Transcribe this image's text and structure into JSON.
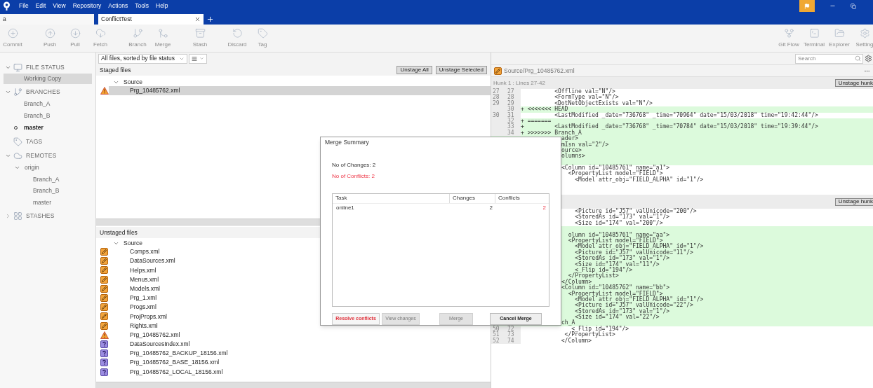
{
  "menu": [
    "File",
    "Edit",
    "View",
    "Repository",
    "Actions",
    "Tools",
    "Help"
  ],
  "tabs": [
    {
      "label": "a",
      "selected": false
    },
    {
      "label": "ConflictTest",
      "selected": true
    }
  ],
  "toolbar": {
    "left": [
      [
        {
          "label": "Commit",
          "kind": "commit"
        }
      ],
      [
        {
          "label": "Push",
          "kind": "push"
        },
        {
          "label": "Pull",
          "kind": "pull"
        },
        {
          "label": "Fetch",
          "kind": "fetch"
        }
      ],
      [
        {
          "label": "Branch",
          "kind": "branch"
        },
        {
          "label": "Merge",
          "kind": "merge"
        }
      ],
      [
        {
          "label": "Stash",
          "kind": "stash"
        }
      ],
      [
        {
          "label": "Discard",
          "kind": "discard"
        },
        {
          "label": "Tag",
          "kind": "tag"
        }
      ]
    ],
    "right": [
      {
        "label": "Git Flow",
        "kind": "gitflow"
      },
      {
        "label": "Terminal",
        "kind": "terminal"
      },
      {
        "label": "Explorer",
        "kind": "explorer"
      },
      {
        "label": "Setting",
        "kind": "settings"
      }
    ]
  },
  "sidebar": [
    {
      "label": "FILE STATUS",
      "kind": "status",
      "expanded": true,
      "children": [
        {
          "label": "Working Copy",
          "selected": true
        }
      ]
    },
    {
      "label": "BRANCHES",
      "kind": "branches",
      "expanded": true,
      "children": [
        {
          "label": "Branch_A",
          "current": false
        },
        {
          "label": "Branch_B",
          "current": false
        },
        {
          "label": "master",
          "current": true
        }
      ]
    },
    {
      "label": "TAGS",
      "kind": "tags"
    },
    {
      "label": "REMOTES",
      "kind": "remotes",
      "expanded": true,
      "children": [
        {
          "label": "origin",
          "expanded": true,
          "children": [
            {
              "label": "Branch_A"
            },
            {
              "label": "Branch_B"
            },
            {
              "label": "master"
            }
          ]
        }
      ]
    },
    {
      "label": "STASHES",
      "kind": "stashes",
      "expanded": false
    }
  ],
  "file_filter": "All files, sorted by file status",
  "search": {
    "placeholder": "Search"
  },
  "staged": {
    "title": "Staged files",
    "buttons": [
      "Unstage All",
      "Unstage Selected"
    ],
    "folder": {
      "label": "Source",
      "expanded": true
    },
    "files": [
      {
        "name": "Prg_10485762.xml",
        "kind": "conflict",
        "selected": true
      }
    ]
  },
  "unstaged": {
    "title": "Unstaged files",
    "folder": {
      "label": "Source",
      "expanded": true
    },
    "files": [
      {
        "name": "Comps.xml",
        "kind": "modified",
        "selected": false
      },
      {
        "name": "DataSources.xml",
        "kind": "modified",
        "selected": false
      },
      {
        "name": "Helps.xml",
        "kind": "modified",
        "selected": false
      },
      {
        "name": "Menus.xml",
        "kind": "modified",
        "selected": false
      },
      {
        "name": "Models.xml",
        "kind": "modified",
        "selected": false
      },
      {
        "name": "Prg_1.xml",
        "kind": "modified",
        "selected": false
      },
      {
        "name": "Progs.xml",
        "kind": "modified",
        "selected": false
      },
      {
        "name": "ProjProps.xml",
        "kind": "modified",
        "selected": false
      },
      {
        "name": "Rights.xml",
        "kind": "modified",
        "selected": false
      },
      {
        "name": "Prg_10485762.xml",
        "kind": "conflict",
        "selected": false
      },
      {
        "name": "DataSourcesIndex.xml",
        "kind": "untracked",
        "selected": false
      },
      {
        "name": "Prg_10485762_BACKUP_18156.xml",
        "kind": "untracked",
        "selected": false
      },
      {
        "name": "Prg_10485762_BASE_18156.xml",
        "kind": "untracked",
        "selected": false
      },
      {
        "name": "Prg_10485762_LOCAL_18156.xml",
        "kind": "untracked",
        "selected": false
      }
    ]
  },
  "diff": {
    "path": "Source/Prg_10485762.xml",
    "hunks": [
      {
        "header": "Hunk 1 : Lines 27-42",
        "button": "Unstage hunk",
        "lines": [
          {
            "old": "27",
            "new": "27",
            "kind": "context",
            "text": "          <Offline val=\"N\"/>"
          },
          {
            "old": "28",
            "new": "28",
            "kind": "context",
            "text": "          <FormType val=\"N\"/>"
          },
          {
            "old": "29",
            "new": "29",
            "kind": "context",
            "text": "          <DotNetObjectExists val=\"N\"/>"
          },
          {
            "new": "30",
            "kind": "added",
            "text": "+ <<<<<<< HEAD"
          },
          {
            "old": "30",
            "new": "31",
            "kind": "context",
            "text": "          <LastModified _date=\"736768\" _time=\"70964\" date=\"15/03/2018\" time=\"19:42:44\"/>"
          },
          {
            "new": "32",
            "kind": "added",
            "text": "+ ======="
          },
          {
            "new": "33",
            "kind": "added",
            "text": "+         <LastModified _date=\"736768\" _time=\"70784\" date=\"15/03/2018\" time=\"19:39:44\"/>"
          },
          {
            "new": "34",
            "kind": "added",
            "text": "+ >>>>>>> Branch_A"
          },
          {
            "kind": "added",
            "covered": true,
            "text": "ader>"
          },
          {
            "kind": "added",
            "covered": true,
            "text": "mIsn val=\"2\"/>"
          },
          {
            "kind": "added",
            "covered": true,
            "text": "ource>"
          },
          {
            "kind": "added",
            "covered": true,
            "text": "olumns>"
          },
          {
            "kind": "added"
          },
          {
            "kind": "context",
            "covered": true,
            "text": "<Column id=\"10485761\" name=\"a1\">"
          },
          {
            "kind": "context",
            "covered": true,
            "text": "  <PropertyList model=\"FIELD\">"
          },
          {
            "kind": "context",
            "covered": true,
            "text": "    <Model attr_obj=\"FIELD_ALPHA\" id=\"1\"/>"
          },
          {
            "kind": "context"
          },
          {
            "kind": "context"
          }
        ]
      },
      {
        "button": "Unstage hunk",
        "lines": [
          {
            "kind": "context",
            "covered": true,
            "text": "    <Picture id=\"J57\" valUnicode=\"200\"/>"
          },
          {
            "kind": "context",
            "covered": true,
            "text": "    <StoredAs id=\"173\" val=\"1\"/>"
          },
          {
            "kind": "context",
            "covered": true,
            "text": "    <Size id=\"174\" val=\"200\"/>"
          },
          {
            "kind": "added"
          },
          {
            "kind": "added",
            "covered": true,
            "text": "  olumn id=\"10485761\" name=\"aa\">"
          },
          {
            "kind": "added",
            "covered": true,
            "text": "  <PropertyList model=\"FIELD\">"
          },
          {
            "kind": "added",
            "covered": true,
            "text": "    <Model attr_obj=\"FIELD_ALPHA\" id=\"1\"/>"
          },
          {
            "kind": "added",
            "covered": true,
            "text": "    <Picture id=\"J57\" valUnicode=\"11\"/>"
          },
          {
            "kind": "added",
            "covered": true,
            "text": "    <StoredAs id=\"173\" val=\"1\"/>"
          },
          {
            "kind": "added",
            "covered": true,
            "text": "    <Size id=\"174\" val=\"11\"/>"
          },
          {
            "kind": "added",
            "covered": true,
            "text": "    <_Flip id=\"194\"/>"
          },
          {
            "kind": "added",
            "covered": true,
            "text": "  </PropertyList>"
          },
          {
            "kind": "added",
            "covered": true,
            "text": "</Column>"
          },
          {
            "kind": "added",
            "covered": true,
            "text": "<Column id=\"10485762\" name=\"bb\">"
          },
          {
            "kind": "added",
            "covered": true,
            "text": "  <PropertyList model=\"FIELD\">"
          },
          {
            "kind": "added",
            "covered": true,
            "text": "    <Model attr_obj=\"FIELD_ALPHA\" id=\"1\"/>"
          },
          {
            "kind": "added",
            "covered": true,
            "text": "    <Picture id=\"J57\" valUnicode=\"22\"/>"
          },
          {
            "kind": "added",
            "covered": true,
            "text": "    <StoredAs id=\"173\" val=\"1\"/>"
          },
          {
            "kind": "added",
            "covered": true,
            "text": "    <Size id=\"174\" val=\"22\"/>"
          },
          {
            "kind": "added",
            "covered": true,
            "text": "ch_A"
          },
          {
            "old": "50",
            "new": "72",
            "kind": "context",
            "text": "               <_Flip id=\"194\"/>"
          },
          {
            "old": "51",
            "new": "73",
            "kind": "context",
            "text": "             </PropertyList>"
          },
          {
            "old": "52",
            "new": "74",
            "kind": "context",
            "text": "            </Column>"
          }
        ]
      }
    ]
  },
  "dialog": {
    "title": "Merge Summary",
    "changes": "No of Changes: 2",
    "conflicts": "No of Conflicts: 2",
    "columns": [
      "Task",
      "Changes",
      "Conflicts"
    ],
    "rows": [
      {
        "task": "online1",
        "changes": "2",
        "conflicts": "2"
      }
    ],
    "buttons": [
      {
        "label": "Resolve conflicts",
        "kind": "danger",
        "disabled": false
      },
      {
        "label": "View changes",
        "disabled": true
      },
      {
        "label": "Merge",
        "disabled": true
      },
      {
        "label": "Cancel Merge",
        "kind": "primary",
        "disabled": false
      }
    ]
  }
}
